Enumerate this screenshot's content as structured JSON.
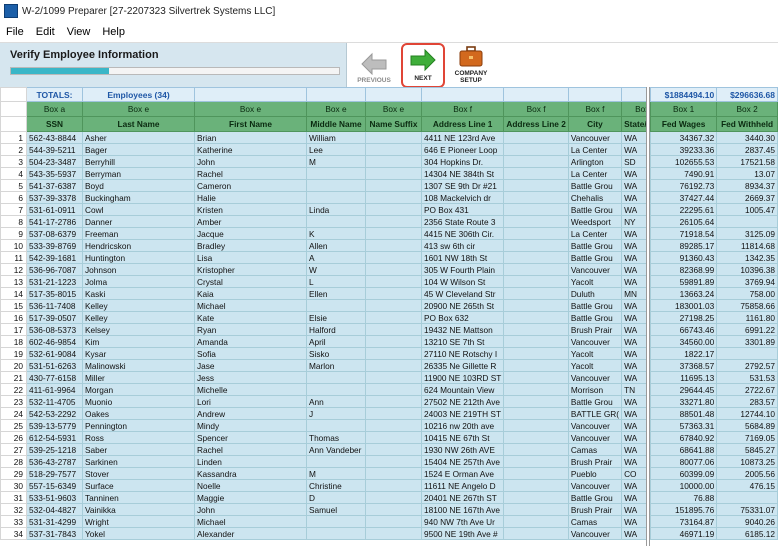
{
  "window": {
    "title": "W-2/1099 Preparer [27-2207323 Silvertrek Systems LLC]"
  },
  "menu": [
    "File",
    "Edit",
    "View",
    "Help"
  ],
  "panel": {
    "title": "Verify Employee Information",
    "progress": 0.3
  },
  "toolbar": {
    "previous": "PREVIOUS",
    "next": "NEXT",
    "company_setup_1": "COMPANY",
    "company_setup_2": "SETUP"
  },
  "totals": {
    "label": "TOTALS:",
    "employees": "Employees (34)",
    "box1": "$1884494.10",
    "box2": "$296636.68"
  },
  "box_row": [
    "Box a",
    "Box e",
    "Box e",
    "Box e",
    "Box e",
    "Box f",
    "Box f",
    "Box f",
    "Box"
  ],
  "columns": [
    "SSN",
    "Last Name",
    "First Name",
    "Middle Name",
    "Name Suffix",
    "Address Line 1",
    "Address Line 2",
    "City",
    "State/Pro"
  ],
  "right_box_row": [
    "Box 1",
    "Box 2"
  ],
  "right_columns": [
    "Fed Wages",
    "Fed Withheld"
  ],
  "rows": [
    {
      "n": "1",
      "ssn": "562-43-8844",
      "last": "Asher",
      "first": "Brian",
      "middle": "William",
      "suffix": "",
      "addr1": "4411 NE 123rd Ave",
      "addr2": "",
      "city": "Vancouver",
      "state": "WA",
      "wages": "34367.32",
      "withheld": "3440.30"
    },
    {
      "n": "2",
      "ssn": "544-39-5211",
      "last": "Bager",
      "first": "Katherine",
      "middle": "Lee",
      "suffix": "",
      "addr1": "646 E Pioneer Loop",
      "addr2": "",
      "city": "La Center",
      "state": "WA",
      "wages": "39233.36",
      "withheld": "2837.45"
    },
    {
      "n": "3",
      "ssn": "504-23-3487",
      "last": "Berryhill",
      "first": "John",
      "middle": "M",
      "suffix": "",
      "addr1": "304 Hopkins Dr.",
      "addr2": "",
      "city": "Arlington",
      "state": "SD",
      "wages": "102655.53",
      "withheld": "17521.58"
    },
    {
      "n": "4",
      "ssn": "543-35-5937",
      "last": "Berryman",
      "first": "Rachel",
      "middle": "",
      "suffix": "",
      "addr1": "14304 NE 384th St",
      "addr2": "",
      "city": "La Center",
      "state": "WA",
      "wages": "7490.91",
      "withheld": "13.07"
    },
    {
      "n": "5",
      "ssn": "541-37-6387",
      "last": "Boyd",
      "first": "Cameron",
      "middle": "",
      "suffix": "",
      "addr1": "1307 SE 9th Dr #21",
      "addr2": "",
      "city": "Battle Grou",
      "state": "WA",
      "wages": "76192.73",
      "withheld": "8934.37"
    },
    {
      "n": "6",
      "ssn": "537-39-3378",
      "last": "Buckingham",
      "first": "Halie",
      "middle": "",
      "suffix": "",
      "addr1": "108 Mackelvich dr",
      "addr2": "",
      "city": "Chehalis",
      "state": "WA",
      "wages": "37427.44",
      "withheld": "2669.37"
    },
    {
      "n": "7",
      "ssn": "531-61-0911",
      "last": "Cowl",
      "first": "Kristen",
      "middle": "Linda",
      "suffix": "",
      "addr1": "PO Box 431",
      "addr2": "",
      "city": "Battle Grou",
      "state": "WA",
      "wages": "22295.61",
      "withheld": "1005.47"
    },
    {
      "n": "8",
      "ssn": "541-17-2786",
      "last": "Danner",
      "first": "Amber",
      "middle": "",
      "suffix": "",
      "addr1": "2356 State Route 3",
      "addr2": "",
      "city": "Weedsport",
      "state": "NY",
      "wages": "26105.64",
      "withheld": ""
    },
    {
      "n": "9",
      "ssn": "537-08-6379",
      "last": "Freeman",
      "first": "Jacque",
      "middle": "K",
      "suffix": "",
      "addr1": "4415 NE 306th Cir.",
      "addr2": "",
      "city": "La Center",
      "state": "WA",
      "wages": "71918.54",
      "withheld": "3125.09"
    },
    {
      "n": "10",
      "ssn": "533-39-8769",
      "last": "Hendricskon",
      "first": "Bradley",
      "middle": "Allen",
      "suffix": "",
      "addr1": "413 sw 6th cir",
      "addr2": "",
      "city": "Battle Grou",
      "state": "WA",
      "wages": "89285.17",
      "withheld": "11814.68"
    },
    {
      "n": "11",
      "ssn": "542-39-1681",
      "last": "Huntington",
      "first": "Lisa",
      "middle": "A",
      "suffix": "",
      "addr1": "1601 NW 18th St",
      "addr2": "",
      "city": "Battle Grou",
      "state": "WA",
      "wages": "91360.43",
      "withheld": "1342.35"
    },
    {
      "n": "12",
      "ssn": "536-96-7087",
      "last": "Johnson",
      "first": "Kristopher",
      "middle": "W",
      "suffix": "",
      "addr1": "305 W Fourth Plain",
      "addr2": "",
      "city": "Vancouver",
      "state": "WA",
      "wages": "82368.99",
      "withheld": "10396.38"
    },
    {
      "n": "13",
      "ssn": "531-21-1223",
      "last": "Jolma",
      "first": "Crystal",
      "middle": "L",
      "suffix": "",
      "addr1": "104 W Wilson St",
      "addr2": "",
      "city": "Yacolt",
      "state": "WA",
      "wages": "59891.89",
      "withheld": "3769.94"
    },
    {
      "n": "14",
      "ssn": "517-35-8015",
      "last": "Kaski",
      "first": "Kaia",
      "middle": "Ellen",
      "suffix": "",
      "addr1": "45 W Cleveland Str",
      "addr2": "",
      "city": "Duluth",
      "state": "MN",
      "wages": "13663.24",
      "withheld": "758.00"
    },
    {
      "n": "15",
      "ssn": "536-11-7408",
      "last": "Kelley",
      "first": "Michael",
      "middle": "",
      "suffix": "",
      "addr1": "20900 NE 265th St",
      "addr2": "",
      "city": "Battle Grou",
      "state": "WA",
      "wages": "183001.03",
      "withheld": "75858.66"
    },
    {
      "n": "16",
      "ssn": "517-39-0507",
      "last": "Kelley",
      "first": "Kate",
      "middle": "Elsie",
      "suffix": "",
      "addr1": "PO Box 632",
      "addr2": "",
      "city": "Battle Grou",
      "state": "WA",
      "wages": "27198.25",
      "withheld": "1161.80"
    },
    {
      "n": "17",
      "ssn": "536-08-5373",
      "last": "Kelsey",
      "first": "Ryan",
      "middle": "Halford",
      "suffix": "",
      "addr1": "19432 NE Mattson",
      "addr2": "",
      "city": "Brush Prair",
      "state": "WA",
      "wages": "66743.46",
      "withheld": "6991.22"
    },
    {
      "n": "18",
      "ssn": "602-46-9854",
      "last": "Kim",
      "first": "Amanda",
      "middle": "April",
      "suffix": "",
      "addr1": "13210 SE 7th St",
      "addr2": "",
      "city": "Vancouver",
      "state": "WA",
      "wages": "34560.00",
      "withheld": "3301.89"
    },
    {
      "n": "19",
      "ssn": "532-61-9084",
      "last": "Kysar",
      "first": "Sofia",
      "middle": "Sisko",
      "suffix": "",
      "addr1": "27110 NE Rotschy I",
      "addr2": "",
      "city": "Yacolt",
      "state": "WA",
      "wages": "1822.17",
      "withheld": ""
    },
    {
      "n": "20",
      "ssn": "531-51-6263",
      "last": "Malinowski",
      "first": "Jase",
      "middle": "Marlon",
      "suffix": "",
      "addr1": "26335 Ne Gillette R",
      "addr2": "",
      "city": "Yacolt",
      "state": "WA",
      "wages": "37368.57",
      "withheld": "2792.57"
    },
    {
      "n": "21",
      "ssn": "430-77-6158",
      "last": "Miller",
      "first": "Jess",
      "middle": "",
      "suffix": "",
      "addr1": "11900 NE 103RD ST",
      "addr2": "",
      "city": "Vancouver",
      "state": "WA",
      "wages": "11695.13",
      "withheld": "531.53"
    },
    {
      "n": "22",
      "ssn": "411-61-9964",
      "last": "Morgan",
      "first": "Michelle",
      "middle": "",
      "suffix": "",
      "addr1": "624 Mountain View",
      "addr2": "",
      "city": "Morrison",
      "state": "TN",
      "wages": "29644.45",
      "withheld": "2722.67"
    },
    {
      "n": "23",
      "ssn": "532-11-4705",
      "last": "Muonio",
      "first": "Lori",
      "middle": "Ann",
      "suffix": "",
      "addr1": "27502 NE 212th Ave",
      "addr2": "",
      "city": "Battle Grou",
      "state": "WA",
      "wages": "33271.80",
      "withheld": "283.57"
    },
    {
      "n": "24",
      "ssn": "542-53-2292",
      "last": "Oakes",
      "first": "Andrew",
      "middle": "J",
      "suffix": "",
      "addr1": "24003 NE 219TH ST",
      "addr2": "",
      "city": "BATTLE GR(",
      "state": "WA",
      "wages": "88501.48",
      "withheld": "12744.10"
    },
    {
      "n": "25",
      "ssn": "539-13-5779",
      "last": "Pennington",
      "first": "Mindy",
      "middle": "",
      "suffix": "",
      "addr1": "10216 nw 20th ave",
      "addr2": "",
      "city": "Vancouver",
      "state": "WA",
      "wages": "57363.31",
      "withheld": "5684.89"
    },
    {
      "n": "26",
      "ssn": "612-54-5931",
      "last": "Ross",
      "first": "Spencer",
      "middle": "Thomas",
      "suffix": "",
      "addr1": "10415 NE 67th St",
      "addr2": "",
      "city": "Vancouver",
      "state": "WA",
      "wages": "67840.92",
      "withheld": "7169.05"
    },
    {
      "n": "27",
      "ssn": "539-25-1218",
      "last": "Saber",
      "first": "Rachel",
      "middle": "Ann Vandeber",
      "suffix": "",
      "addr1": "1930 NW 26th AVE",
      "addr2": "",
      "city": "Camas",
      "state": "WA",
      "wages": "68641.88",
      "withheld": "5845.27"
    },
    {
      "n": "28",
      "ssn": "536-43-2787",
      "last": "Sarkinen",
      "first": "Linden",
      "middle": "",
      "suffix": "",
      "addr1": "15404 NE 257th Ave",
      "addr2": "",
      "city": "Brush Prair",
      "state": "WA",
      "wages": "80077.06",
      "withheld": "10873.25"
    },
    {
      "n": "29",
      "ssn": "518-29-7577",
      "last": "Stover",
      "first": "Kassandra",
      "middle": "M",
      "suffix": "",
      "addr1": "1524 E Orman Ave",
      "addr2": "",
      "city": "Pueblo",
      "state": "CO",
      "wages": "60399.09",
      "withheld": "2005.56"
    },
    {
      "n": "30",
      "ssn": "557-15-6349",
      "last": "Surface",
      "first": "Noelle",
      "middle": "Christine",
      "suffix": "",
      "addr1": "11611 NE Angelo D",
      "addr2": "",
      "city": "Vancouver",
      "state": "WA",
      "wages": "10000.00",
      "withheld": "476.15"
    },
    {
      "n": "31",
      "ssn": "533-51-9603",
      "last": "Tanninen",
      "first": "Maggie",
      "middle": "D",
      "suffix": "",
      "addr1": "20401 NE 267th ST",
      "addr2": "",
      "city": "Battle Grou",
      "state": "WA",
      "wages": "76.88",
      "withheld": ""
    },
    {
      "n": "32",
      "ssn": "532-04-4827",
      "last": "Vainikka",
      "first": "John",
      "middle": "Samuel",
      "suffix": "",
      "addr1": "18100 NE 167th Ave",
      "addr2": "",
      "city": "Brush Prair",
      "state": "WA",
      "wages": "151895.76",
      "withheld": "75331.07"
    },
    {
      "n": "33",
      "ssn": "531-31-4299",
      "last": "Wright",
      "first": "Michael",
      "middle": "",
      "suffix": "",
      "addr1": "940 NW 7th Ave Ur",
      "addr2": "",
      "city": "Camas",
      "state": "WA",
      "wages": "73164.87",
      "withheld": "9040.26"
    },
    {
      "n": "34",
      "ssn": "537-31-7843",
      "last": "Yokel",
      "first": "Alexander",
      "middle": "",
      "suffix": "",
      "addr1": "9500 NE 19th Ave #",
      "addr2": "",
      "city": "Vancouver",
      "state": "WA",
      "wages": "46971.19",
      "withheld": "6185.12"
    }
  ]
}
